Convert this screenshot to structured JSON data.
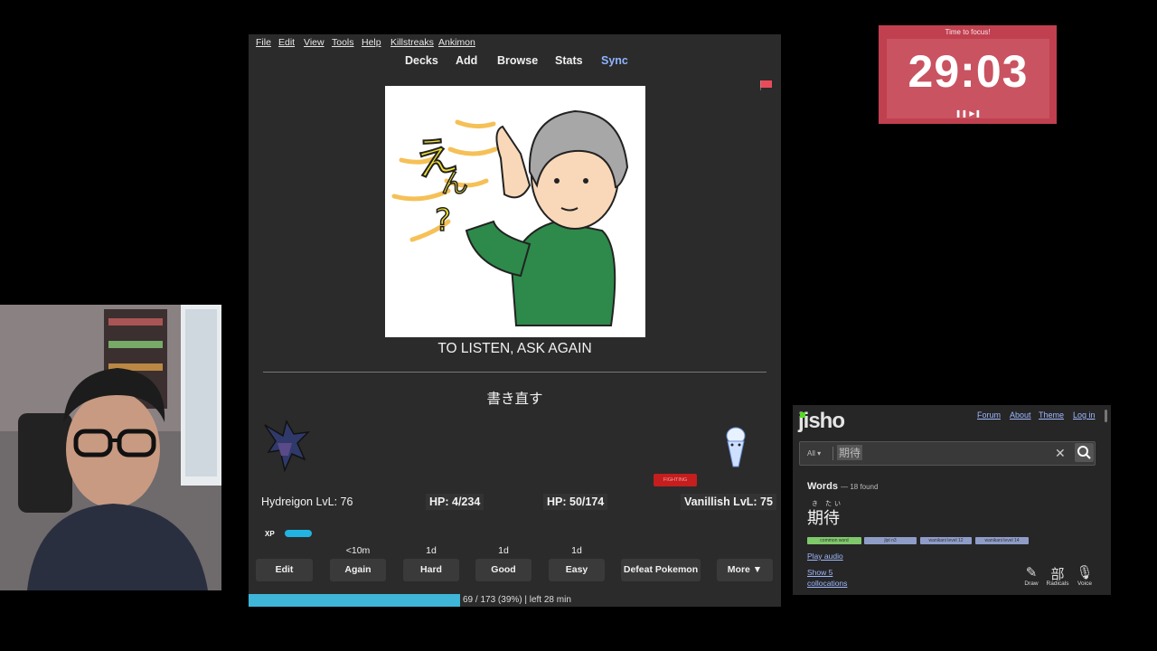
{
  "anki": {
    "menu": [
      "File",
      "Edit",
      "View",
      "Tools",
      "Help",
      "Killstreaks",
      "Ankimon"
    ],
    "tabs": [
      "Decks",
      "Add",
      "Browse",
      "Stats",
      "Sync"
    ],
    "card_text": "TO LISTEN, ASK AGAIN",
    "answer": "書き直す",
    "player": {
      "name": "Hydreigon LvL: 76",
      "hp": "HP: 4/234"
    },
    "enemy": {
      "name": "Vanillish LvL: 75",
      "hp": "HP: 50/174",
      "status": "FIGHTING"
    },
    "xp_label": "XP",
    "intervals": [
      "<10m",
      "1d",
      "1d",
      "1d"
    ],
    "buttons": {
      "edit": "Edit",
      "again": "Again",
      "hard": "Hard",
      "good": "Good",
      "easy": "Easy",
      "defeat": "Defeat Pokemon",
      "more": "More ▼"
    },
    "progress": {
      "text": "69 / 173 (39%) | left 28 min",
      "fraction": 0.39
    },
    "flag_color": "#e84c5a"
  },
  "timer": {
    "title": "Time to focus!",
    "time": "29:03",
    "controls": "❚❚ ▶❚"
  },
  "jisho": {
    "logo": "jisho",
    "links": [
      "Forum",
      "About",
      "Theme",
      "Log in"
    ],
    "search_scope": "All ▾",
    "search_value": "期待",
    "words_heading": "Words",
    "words_count": "— 18 found",
    "furigana": "き たい",
    "word": "期待",
    "tags": [
      "common word",
      "jlpt n3",
      "wanikani level 12",
      "wanikani level 14"
    ],
    "play_audio": "Play audio",
    "collocations": [
      "Show 5",
      "collocations"
    ],
    "tools": [
      {
        "glyph": "✎",
        "label": "Draw"
      },
      {
        "glyph": "部",
        "label": "Radicals"
      },
      {
        "glyph": "🎙",
        "label": "Voice"
      }
    ]
  }
}
